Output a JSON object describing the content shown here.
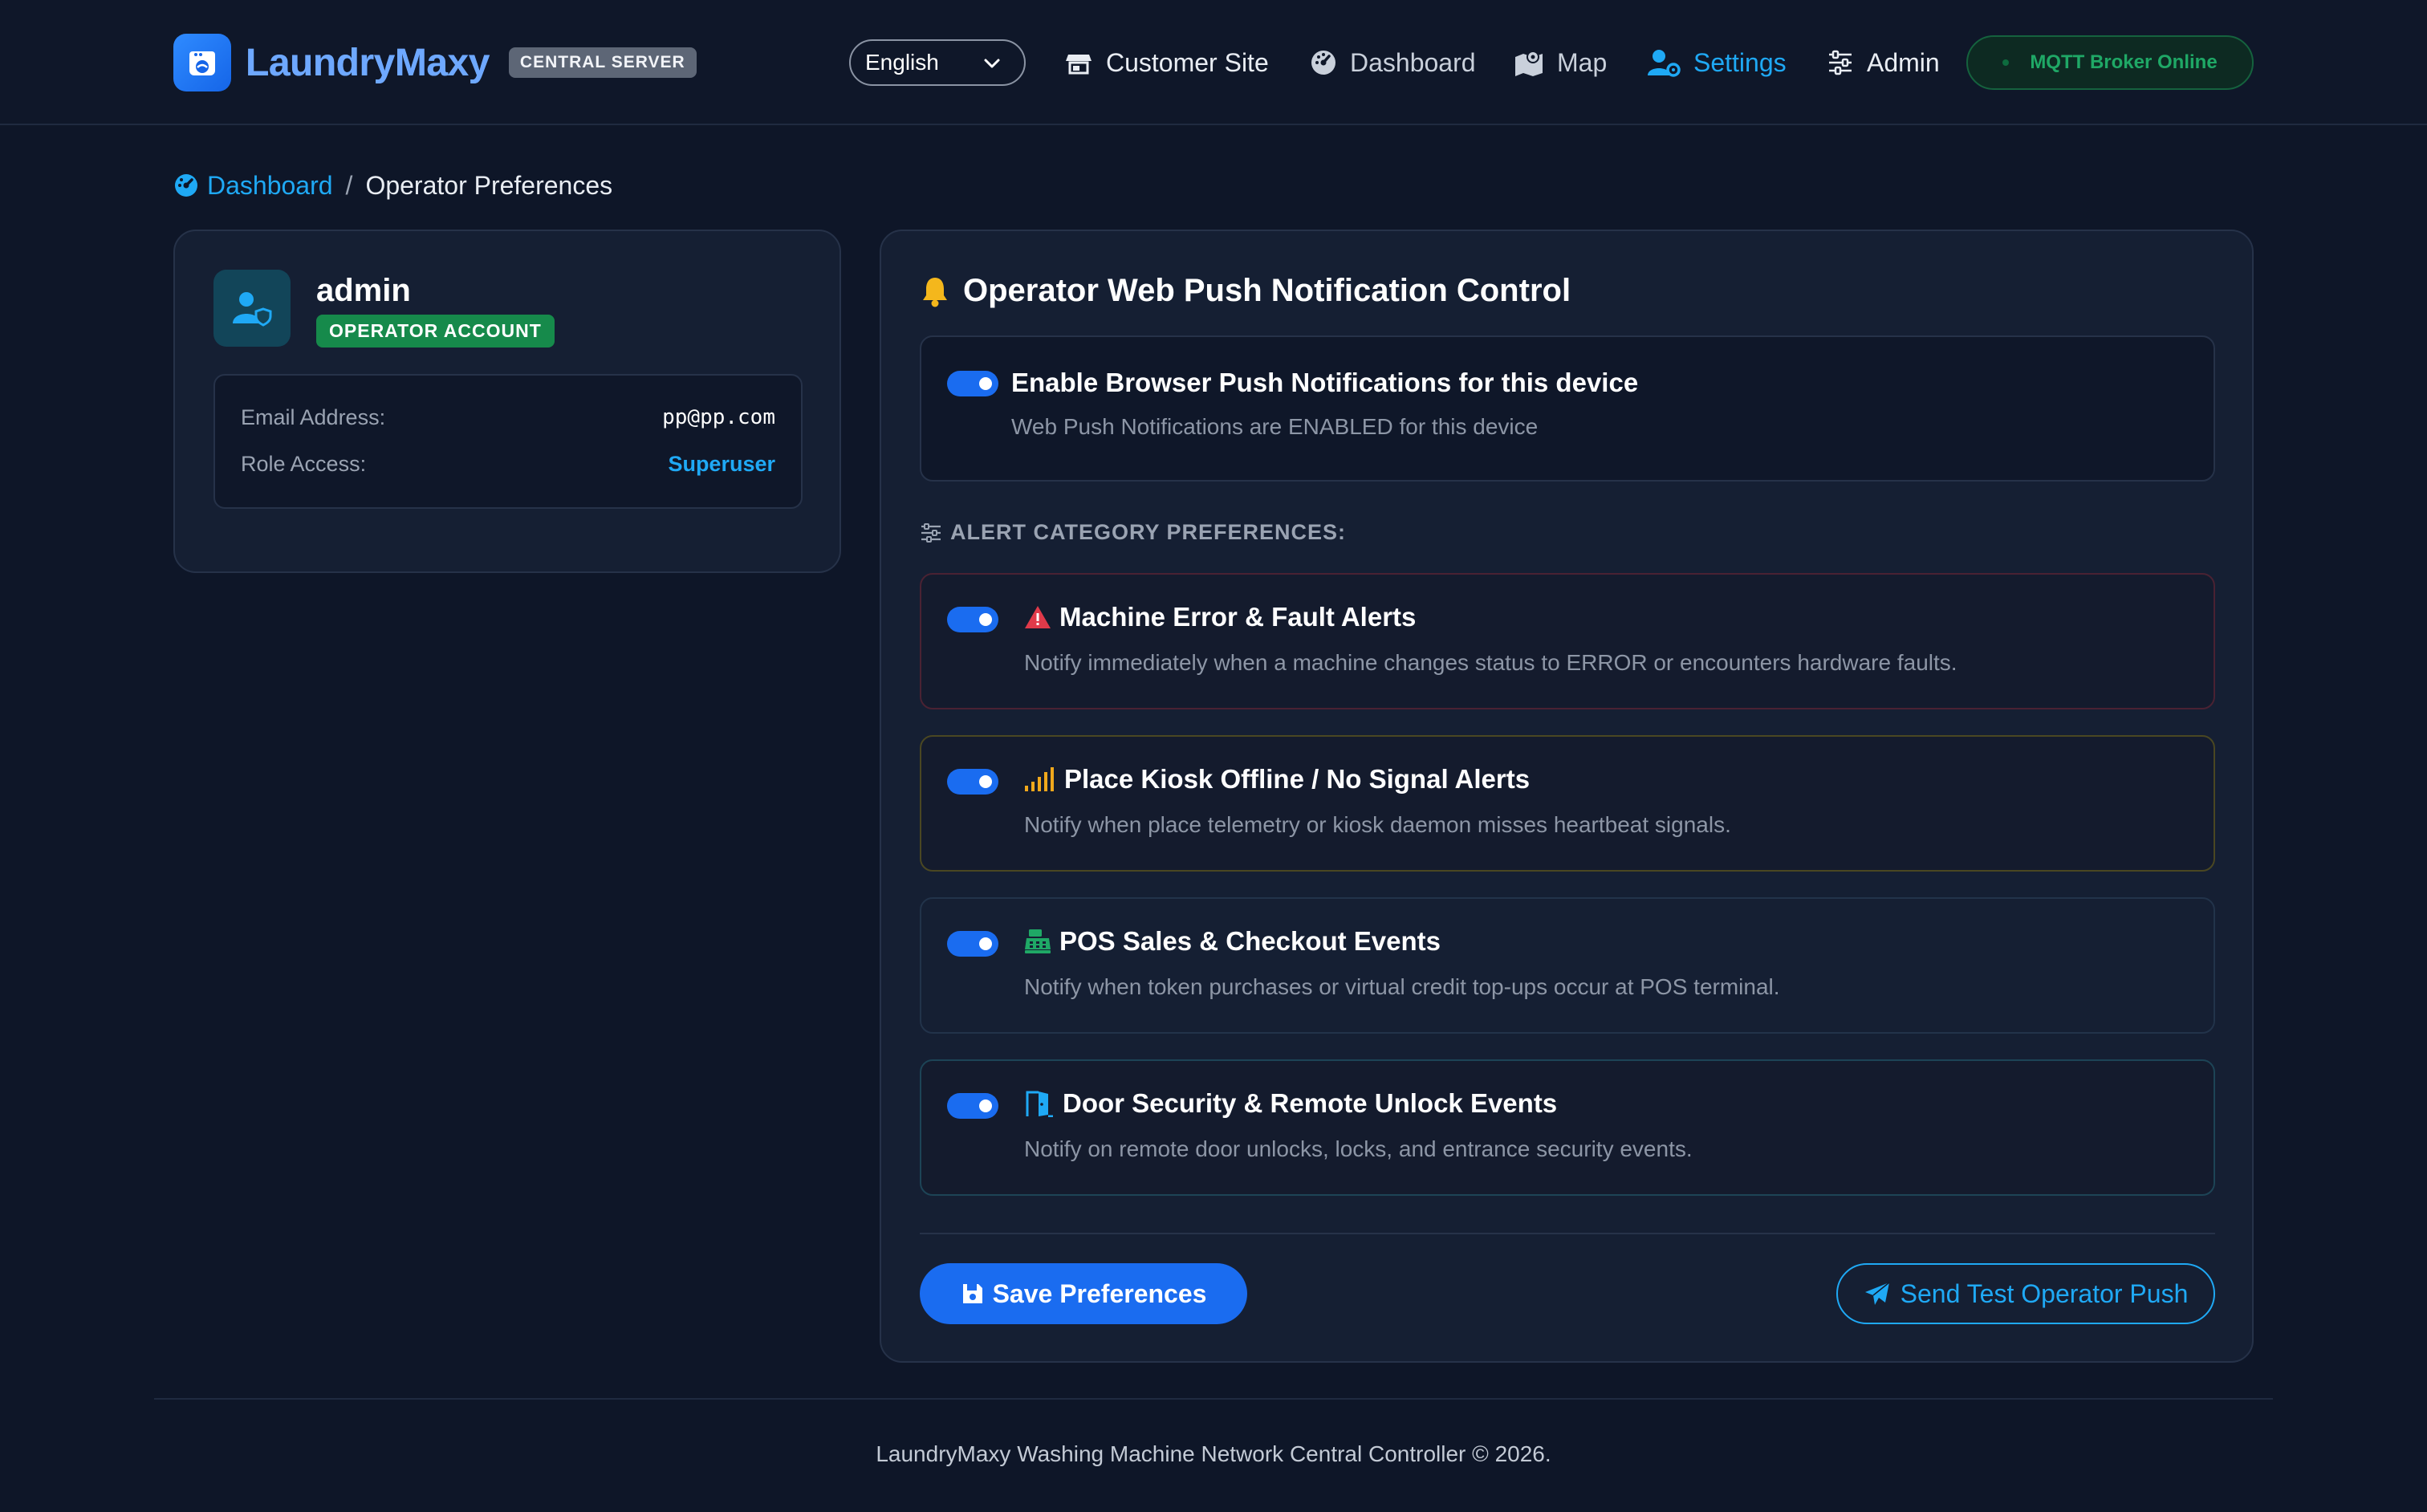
{
  "brand": {
    "name": "LaundryMaxy",
    "badge": "CENTRAL SERVER",
    "logo_icon": "washing-machine-icon"
  },
  "header": {
    "language": {
      "selected": "English",
      "icon": "chevron-down-icon"
    },
    "nav": [
      {
        "label": "Customer Site",
        "icon": "store-icon"
      },
      {
        "label": "Dashboard",
        "icon": "gauge-icon"
      },
      {
        "label": "Map",
        "icon": "map-icon"
      },
      {
        "label": "Settings",
        "icon": "user-gear-icon",
        "active": true
      },
      {
        "label": "Admin",
        "icon": "sliders-icon"
      }
    ],
    "mqtt_status": "MQTT Broker Online"
  },
  "breadcrumb": {
    "home": "Dashboard",
    "separator": "/",
    "current": "Operator Preferences"
  },
  "profile": {
    "username": "admin",
    "badge": "OPERATOR ACCOUNT",
    "email_label": "Email Address:",
    "email": "pp@pp.com",
    "role_label": "Role Access:",
    "role": "Superuser"
  },
  "notifications": {
    "title": "Operator Web Push Notification Control",
    "master": {
      "title": "Enable Browser Push Notifications for this device",
      "status": "Web Push Notifications are ENABLED for this device",
      "enabled": true
    },
    "section_label": "ALERT CATEGORY PREFERENCES:",
    "categories": [
      {
        "title": "Machine Error & Fault Alerts",
        "description": "Notify immediately when a machine changes status to ERROR or encounters hardware faults.",
        "icon": "warning-icon",
        "enabled": true
      },
      {
        "title": "Place Kiosk Offline / No Signal Alerts",
        "description": "Notify when place telemetry or kiosk daemon misses heartbeat signals.",
        "icon": "signal-icon",
        "enabled": true
      },
      {
        "title": "POS Sales & Checkout Events",
        "description": "Notify when token purchases or virtual credit top-ups occur at POS terminal.",
        "icon": "cash-register-icon",
        "enabled": true
      },
      {
        "title": "Door Security & Remote Unlock Events",
        "description": "Notify on remote door unlocks, locks, and entrance security events.",
        "icon": "door-open-icon",
        "enabled": true
      }
    ],
    "save_label": "Save Preferences",
    "test_label": "Send Test Operator Push"
  },
  "footer": {
    "text": "LaundryMaxy Washing Machine Network Central Controller © 2026."
  },
  "colors": {
    "background": "#0e1628",
    "accent_blue": "#1a6cf0",
    "accent_cyan": "#1fa9f5",
    "success_green": "#168a4b",
    "danger_red": "#e03a4a",
    "warning_amber": "#f0a81c"
  }
}
